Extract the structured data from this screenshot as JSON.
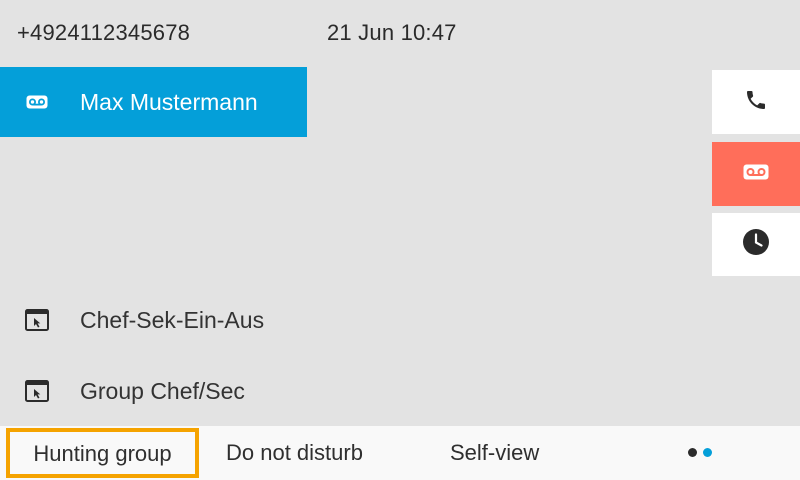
{
  "status": {
    "number": "+4924112345678",
    "datetime": "21 Jun 10:47"
  },
  "list": {
    "items": [
      {
        "label": "Max Mustermann",
        "icon": "voicemail-icon",
        "selected": true
      },
      {
        "label": "Chef-Sek-Ein-Aus",
        "icon": "service-url-icon",
        "selected": false
      },
      {
        "label": "Group Chef/Sec",
        "icon": "service-url-icon",
        "selected": false
      }
    ]
  },
  "side_panel": {
    "buttons": [
      {
        "icon": "phone-icon",
        "active": false
      },
      {
        "icon": "voicemail-icon",
        "active": true
      },
      {
        "icon": "clock-icon",
        "active": false
      }
    ]
  },
  "softkeys": {
    "items": [
      {
        "label": "Hunting group",
        "focused": true
      },
      {
        "label": "Do not disturb",
        "focused": false
      },
      {
        "label": "Self-view",
        "focused": false
      }
    ],
    "page_count": 2,
    "current_page": 2
  },
  "colors": {
    "background": "#e3e3e3",
    "selected": "#049fd9",
    "voicemail_active": "#ff6e5a",
    "focus": "#f5a300",
    "softkey_bar": "#f9f9f9"
  }
}
